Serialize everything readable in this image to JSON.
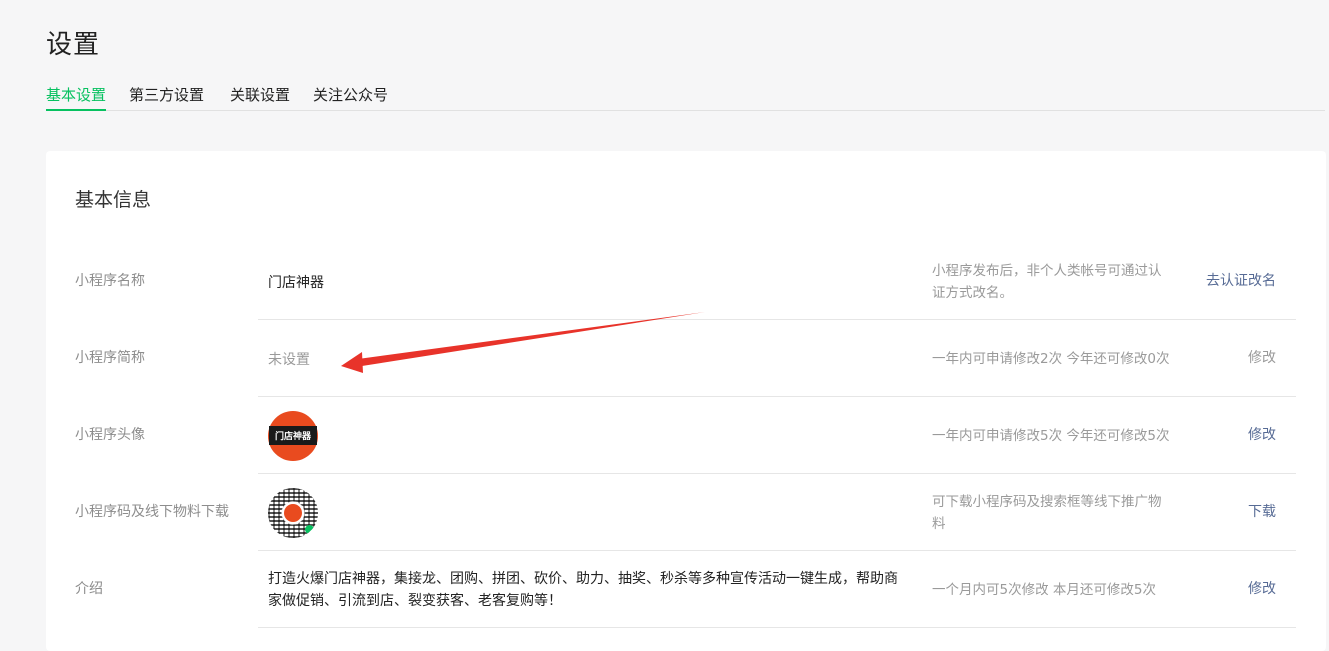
{
  "page": {
    "title": "设置"
  },
  "tabs": [
    {
      "label": "基本设置",
      "active": true
    },
    {
      "label": "第三方设置",
      "active": false
    },
    {
      "label": "关联设置",
      "active": false
    },
    {
      "label": "关注公众号",
      "active": false
    }
  ],
  "card": {
    "title": "基本信息",
    "rows": [
      {
        "label": "小程序名称",
        "value": "门店神器",
        "tip": "小程序发布后，非个人类帐号可通过认证方式改名。",
        "action": "去认证改名"
      },
      {
        "label": "小程序简称",
        "value": "未设置",
        "tip": "一年内可申请修改2次 今年还可修改0次",
        "action": "修改"
      },
      {
        "label": "小程序头像",
        "value_image_text": "门店神器",
        "tip": "一年内可申请修改5次 今年还可修改5次",
        "action": "修改"
      },
      {
        "label": "小程序码及线下物料下载",
        "value_image": "qr-code",
        "tip": "可下载小程序码及搜索框等线下推广物料",
        "action": "下载"
      },
      {
        "label": "介绍",
        "value": "打造火爆门店神器，集接龙、团购、拼团、砍价、助力、抽奖、秒杀等多种宣传活动一键生成，帮助商家做促销、引流到店、裂变获客、老客复购等！",
        "tip": "一个月内可5次修改 本月还可修改5次",
        "action": "修改"
      }
    ]
  },
  "colors": {
    "accent": "#07c160",
    "link": "#576b95",
    "annotation_arrow": "#e8332a",
    "logo_bg": "#e94b1f"
  },
  "icons": {
    "annotation": "red-arrow-icon",
    "avatar": "shop-logo-icon",
    "qr": "qr-code-icon"
  }
}
